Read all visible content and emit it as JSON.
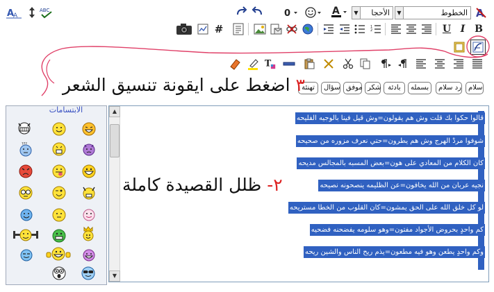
{
  "toolbar": {
    "font_name": "الخطوط",
    "font_size": "الأحجا",
    "spellcheck_label": "ABC",
    "bold": "B",
    "italic": "I",
    "underline": "U",
    "hash": "#",
    "link_symbol": "0",
    "font_color_letter": "A",
    "font_color_bar": "#000000",
    "highlight_bar": "#ffe000",
    "text_style_letter": "T"
  },
  "message_buttons": [
    "سلام",
    "رد سلام",
    "بسمله",
    "بادئة",
    "شكر",
    "موفق",
    "سؤال",
    "تهنئة"
  ],
  "instructions": {
    "step3_number": "٣",
    "step3_text": "اضغط على ايقونة تنسيق الشعر",
    "step2_number": "٢-",
    "step2_text": "ظلل القصيدة كاملة"
  },
  "smilies": {
    "title": "الابتسامات"
  },
  "editor": {
    "lines": [
      "قالوا حكوا بك قلت وش هم يقولون=وش قيل فينا بالوجيه الفليحه",
      "شوفوا مردْ الهرج وش هم يطرون=حتي نعرف مزوره من صحيحه",
      "كان الكلام من المعادي على هون=بعض المسبه بالمجالس مديحه",
      "نجيه عربان من الله يخافون=عن الظليمه ينصحونه نصيحه",
      "لو كل خلق الله على الحق يمشون=كان القلوب من الخطا مستريحه",
      "كم واحدٍ بحروض الأجواد مفتون=وهو سلومه يفضحنه فضحيه",
      "وكم واحدٍ يطعن وهو فيه مطعون=يذم ريح الناس والشين ريحه"
    ]
  }
}
